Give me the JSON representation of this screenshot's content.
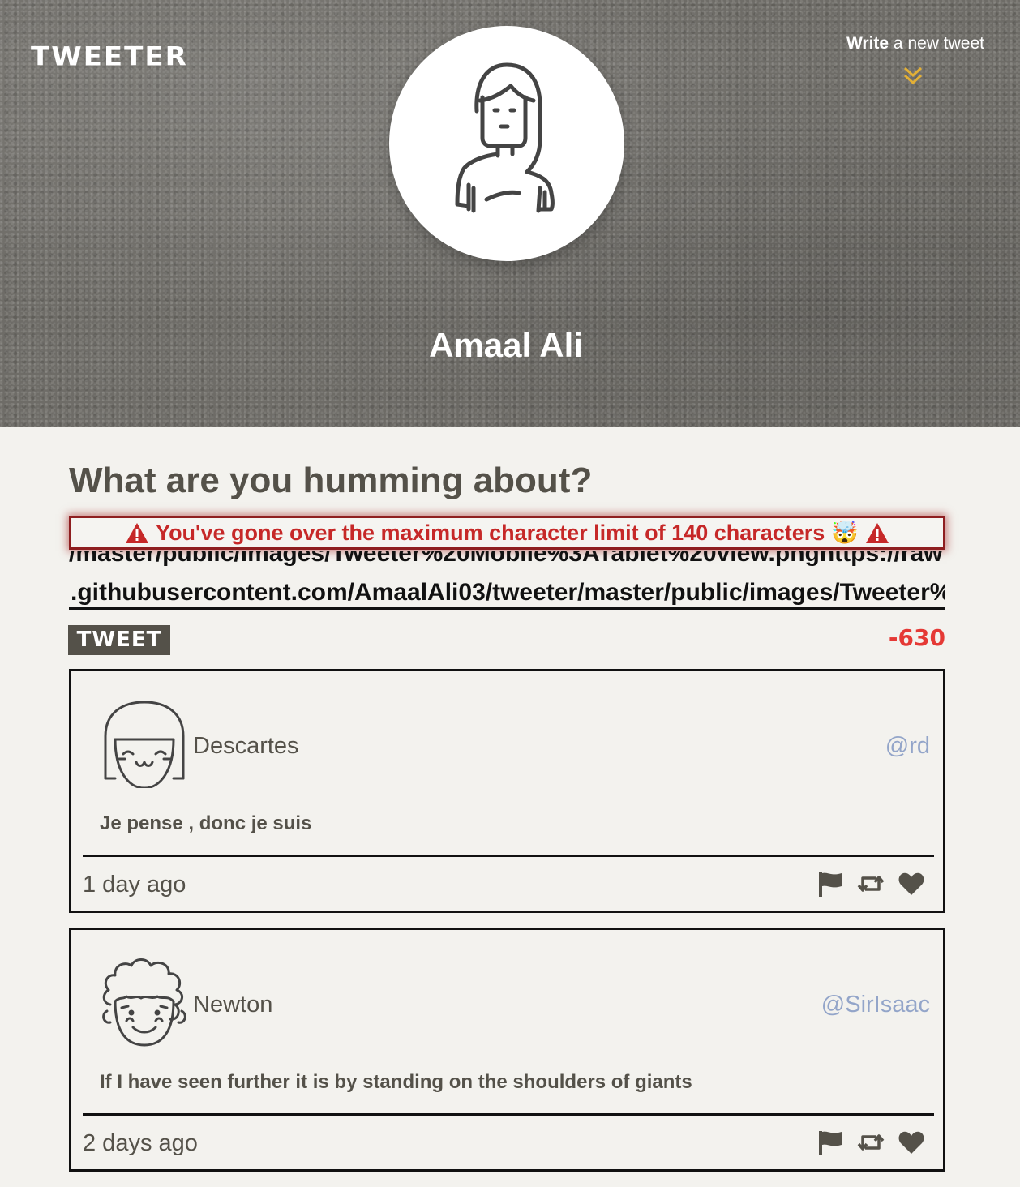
{
  "nav": {
    "logo": "TWEETER",
    "compose_bold": "Write",
    "compose_rest": " a new tweet",
    "compose_icon": "double-chevron-down-icon",
    "accent_color": "#e3b036"
  },
  "profile": {
    "name": "Amaal Ali",
    "avatar_icon": "woman-avatar-icon"
  },
  "composer": {
    "title": "What are you humming about?",
    "error_text": "You've gone over the maximum character limit of 140 characters",
    "error_emoji": "🤯",
    "error_color": "#c62828",
    "text_line_1": "/master/public/images/Tweeter%20Mobile%3ATablet%20view.pnghttps://raw",
    "text_line_2": ".githubusercontent.com/AmaalAli03/tweeter/master/public/images/Tweeter%",
    "submit_label": "TWEET",
    "counter": "-630",
    "counter_color": "#e53935"
  },
  "tweets": [
    {
      "name": "Descartes",
      "handle": "@rd",
      "content": "Je pense , donc je suis",
      "time": "1 day ago",
      "avatar_icon": "girl-avatar-icon"
    },
    {
      "name": "Newton",
      "handle": "@SirIsaac",
      "content": "If I have seen further it is by standing on the shoulders of giants",
      "time": "2 days ago",
      "avatar_icon": "curly-hair-avatar-icon"
    }
  ],
  "actions": [
    "flag-icon",
    "retweet-icon",
    "heart-icon"
  ]
}
